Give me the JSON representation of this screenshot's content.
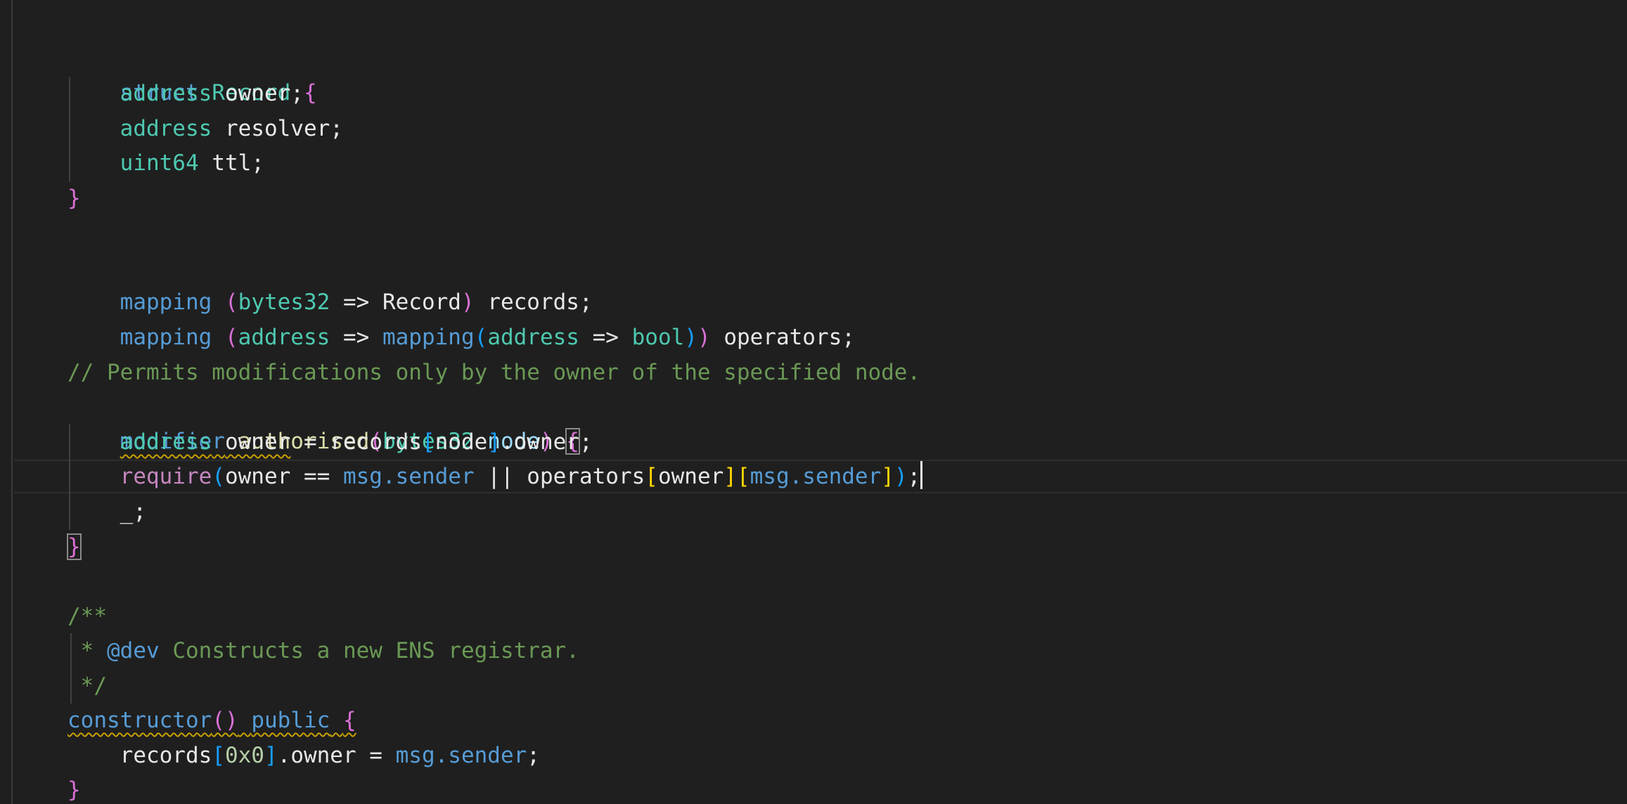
{
  "colors": {
    "background": "#1f1f1f",
    "keyword": "#569cd6",
    "type": "#4ec9b0",
    "function": "#dcdcaa",
    "control": "#c586c0",
    "variable": "#9cdcfe",
    "number": "#b5cea8",
    "comment": "#6a9955",
    "bracket_pink": "#da70d6",
    "bracket_blue": "#179fff",
    "bracket_gold": "#ffd700",
    "warning_squiggle": "#c8a200"
  },
  "code": {
    "l1": {
      "kw": "struct",
      "name": "Record",
      "brace": "{"
    },
    "l2": {
      "type": "address",
      "rest": "owner;"
    },
    "l3": {
      "type": "address",
      "rest": "resolver;"
    },
    "l4": {
      "type": "uint64",
      "rest": "ttl;"
    },
    "l5": {
      "brace": "}"
    },
    "l6": {
      "kw": "mapping",
      "p1": "(",
      "type1": "bytes32",
      "arrow": "=>",
      "ref": "Record",
      "p2": ")",
      "rest": "records;"
    },
    "l7": {
      "kw": "mapping",
      "p1": "(",
      "type1": "address",
      "arrow1": "=>",
      "kw2": "mapping",
      "p3": "(",
      "type2": "address",
      "arrow2": "=>",
      "type3": "bool",
      "p4": ")",
      "p2": ")",
      "rest": "operators;"
    },
    "l8": {
      "comment": "// Permits modifications only by the owner of the specified node."
    },
    "l9": {
      "kw": "modifier",
      "fn": "authorised",
      "p1": "(",
      "type": "bytes32",
      "param": "node",
      "p2": ")",
      "brace": "{"
    },
    "l10": {
      "type": "address",
      "var": "owner",
      "eq": "=",
      "rec": "records",
      "b1": "[",
      "idx": "node",
      "b2": "]",
      "rest": ".owner;"
    },
    "l11": {
      "fn": "require",
      "p1": "(",
      "a": "owner",
      "eq": "==",
      "msg": "msg.sender",
      "or": "||",
      "ops": "operators",
      "b1": "[",
      "o": "owner",
      "b2": "]",
      "b3": "[",
      "m": "msg.sender",
      "b4": "]",
      "p2": ")",
      "semi": ";"
    },
    "l12": {
      "text": "_;"
    },
    "l13": {
      "brace": "}"
    },
    "l14": {
      "text": "/**"
    },
    "l15": {
      "star": "*",
      "tag": "@dev",
      "text": "Constructs a new ENS registrar."
    },
    "l16": {
      "text": "*/"
    },
    "l17": {
      "kw": "constructor",
      "parens": "()",
      "kw2": "public",
      "brace": "{"
    },
    "l18": {
      "rec": "records",
      "b1": "[",
      "num": "0x0",
      "b2": "]",
      "rest": ".owner =",
      "msg": "msg.sender",
      "semi": ";"
    },
    "l19": {
      "brace": "}"
    }
  }
}
